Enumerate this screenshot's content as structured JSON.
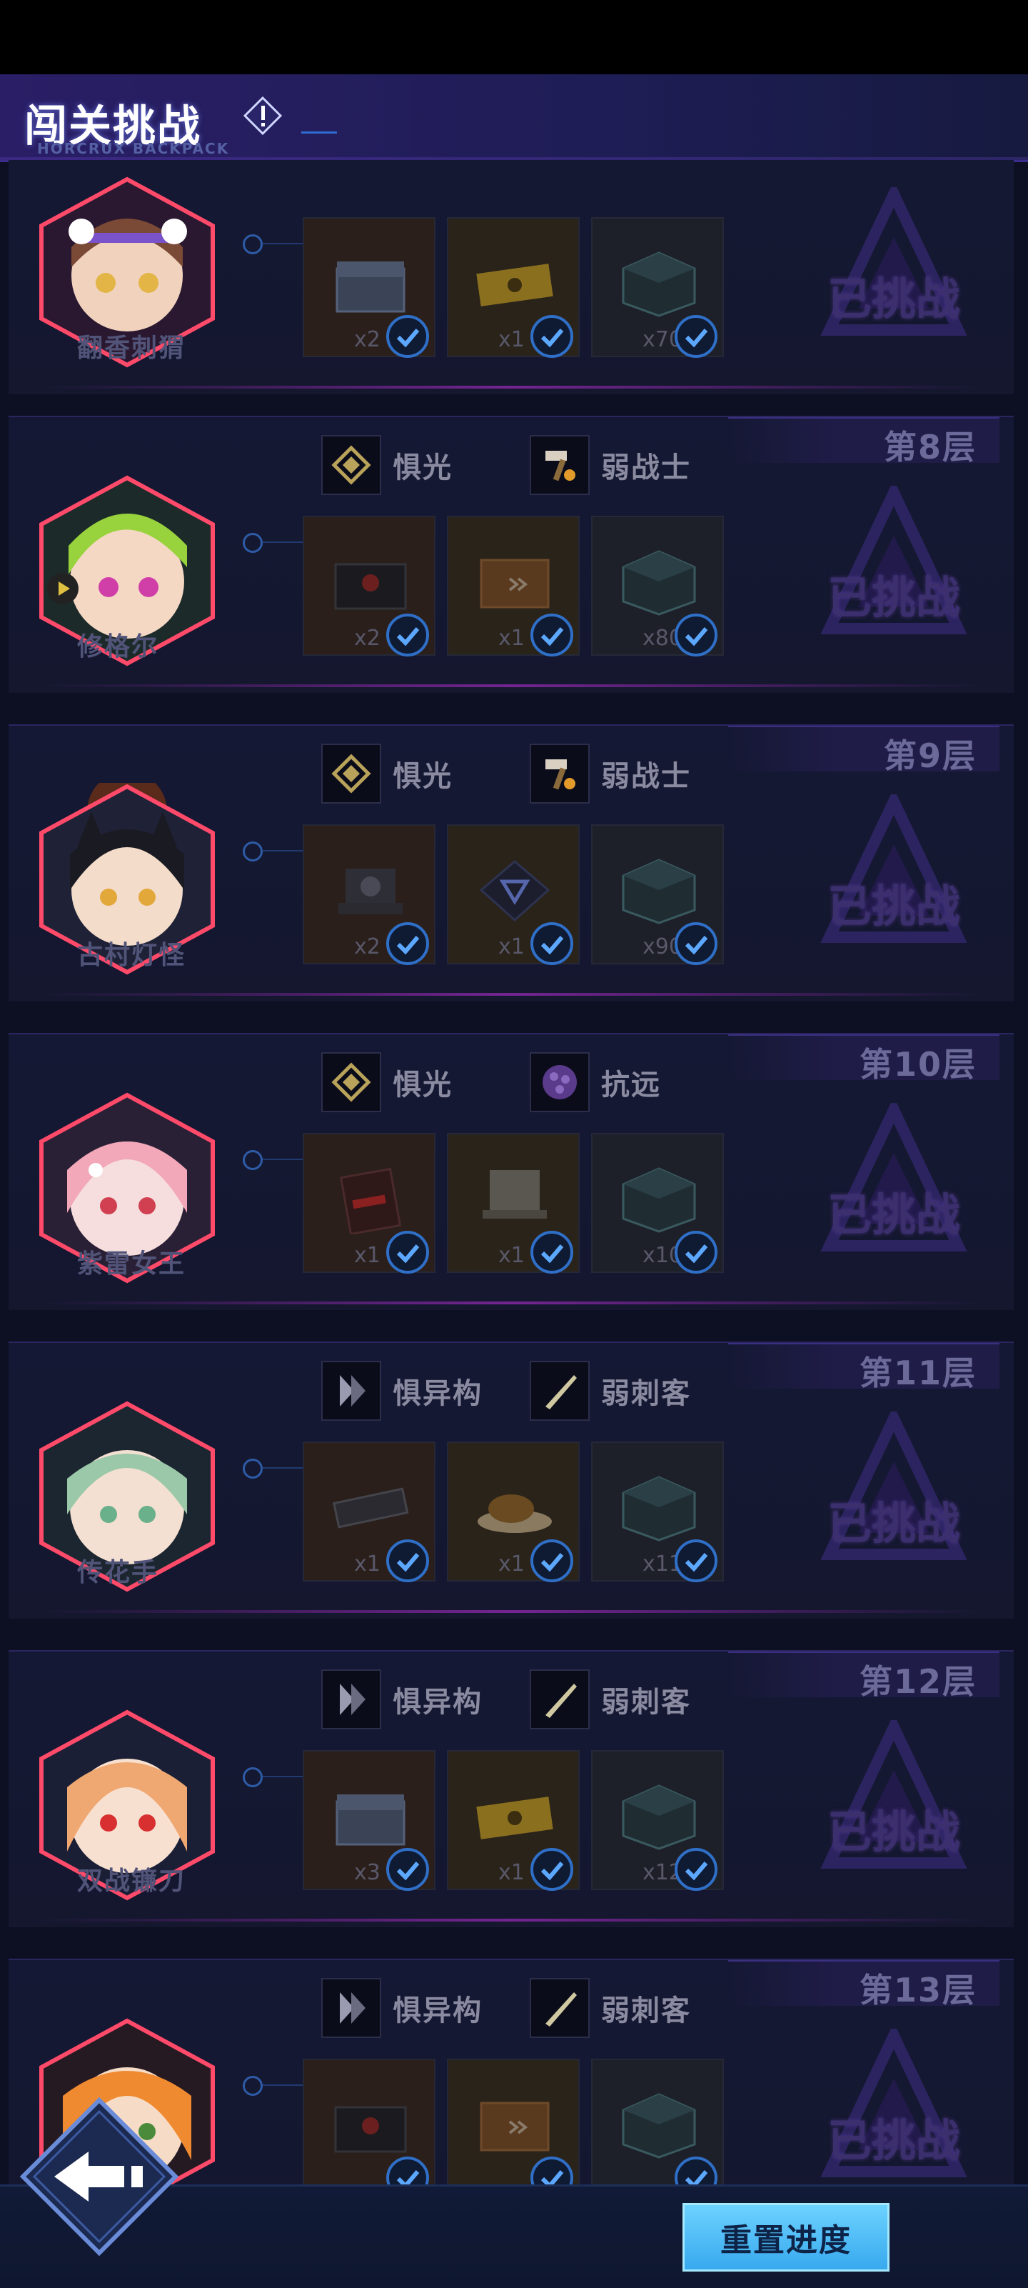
{
  "header": {
    "title": "闯关挑战",
    "subtitle": "HORCRUX BACKPACK"
  },
  "top_card": {
    "character_name": "翻香刺猬",
    "rewards": [
      {
        "icon": "chest-icon",
        "qty": "x2"
      },
      {
        "icon": "ticket-icon",
        "qty": "x1"
      },
      {
        "icon": "cube-icon",
        "qty": "x70"
      }
    ],
    "status": "已挑战"
  },
  "floors": [
    {
      "layer": "第8层",
      "character_name": "修格尔",
      "traits": [
        {
          "icon": "diamond-emblem-icon",
          "label": "惧光"
        },
        {
          "icon": "hammer-icon",
          "label": "弱战士"
        }
      ],
      "rewards": [
        {
          "icon": "black-chest-icon",
          "qty": "x2"
        },
        {
          "icon": "orange-box-icon",
          "qty": "x1"
        },
        {
          "icon": "cube-icon",
          "qty": "x80"
        }
      ],
      "status": "已挑战"
    },
    {
      "layer": "第9层",
      "character_name": "古村灯怪",
      "traits": [
        {
          "icon": "diamond-emblem-icon",
          "label": "惧光"
        },
        {
          "icon": "hammer-icon",
          "label": "弱战士"
        }
      ],
      "rewards": [
        {
          "icon": "mech-icon",
          "qty": "x2"
        },
        {
          "icon": "triangle-core-icon",
          "qty": "x1"
        },
        {
          "icon": "cube-icon",
          "qty": "x90"
        }
      ],
      "status": "已挑战"
    },
    {
      "layer": "第10层",
      "character_name": "紫雷女王",
      "traits": [
        {
          "icon": "diamond-emblem-icon",
          "label": "惧光"
        },
        {
          "icon": "orb-icon",
          "label": "抗远"
        }
      ],
      "rewards": [
        {
          "icon": "card-icon",
          "qty": "x1"
        },
        {
          "icon": "hat-icon",
          "qty": "x1"
        },
        {
          "icon": "cube-icon",
          "qty": "x100"
        }
      ],
      "status": "已挑战"
    },
    {
      "layer": "第11层",
      "character_name": "传花手",
      "traits": [
        {
          "icon": "shard-icon",
          "label": "惧异构"
        },
        {
          "icon": "blade-icon",
          "label": "弱刺客"
        }
      ],
      "rewards": [
        {
          "icon": "device-icon",
          "qty": "x1"
        },
        {
          "icon": "food-plate-icon",
          "qty": "x1"
        },
        {
          "icon": "cube-icon",
          "qty": "x110"
        }
      ],
      "status": "已挑战"
    },
    {
      "layer": "第12层",
      "character_name": "双战镰刀",
      "traits": [
        {
          "icon": "shard-icon",
          "label": "惧异构"
        },
        {
          "icon": "blade-icon",
          "label": "弱刺客"
        }
      ],
      "rewards": [
        {
          "icon": "chest-icon",
          "qty": "x3"
        },
        {
          "icon": "ticket-icon",
          "qty": "x1"
        },
        {
          "icon": "cube-icon",
          "qty": "x120"
        }
      ],
      "status": "已挑战"
    },
    {
      "layer": "第13层",
      "character_name": "",
      "traits": [
        {
          "icon": "shard-icon",
          "label": "惧异构"
        },
        {
          "icon": "blade-icon",
          "label": "弱刺客"
        }
      ],
      "rewards": [
        {
          "icon": "black-chest-icon",
          "qty": ""
        },
        {
          "icon": "orange-box-icon",
          "qty": ""
        },
        {
          "icon": "cube-icon",
          "qty": ""
        }
      ],
      "status": "已挑战"
    }
  ],
  "buttons": {
    "reset_label": "重置进度",
    "back_icon": "back-arrow-icon"
  }
}
